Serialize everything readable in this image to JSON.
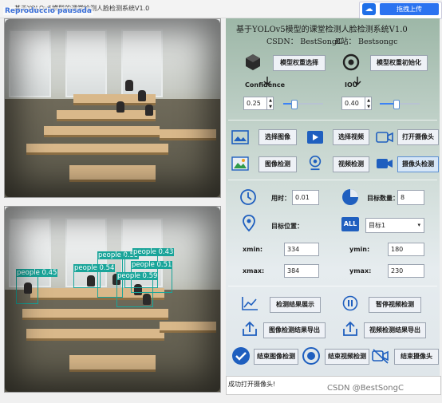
{
  "window": {
    "title": "基于YOLOv5模型的课堂检测人脸检测系统V1.0",
    "overlay_badge": "Reproduccio pausada",
    "upload_label": "拖拽上传"
  },
  "header": {
    "title": "基于YOLOv5模型的课堂检测人脸检测系统V1.0",
    "csdn": "CSDN： BestSongC",
    "bilibili": "B站： Bestsongc"
  },
  "model": {
    "select_label": "模型权重选择",
    "init_label": "模型权重初始化"
  },
  "params": {
    "confidence_label": "Confidence",
    "confidence_value": "0.25",
    "confidence_level": 0.25,
    "iou_label": "IOU",
    "iou_value": "0.40",
    "iou_level": 0.4
  },
  "source": {
    "image_label": "选择图像",
    "video_label": "选择视频",
    "camera_label": "打开摄像头",
    "image_detect_label": "图像检测",
    "video_detect_label": "视频检测",
    "camera_detect_label": "摄像头检测"
  },
  "stats": {
    "time_label": "用时：",
    "time_value": "0.01",
    "count_label": "目标数量：",
    "count_value": "8",
    "position_label": "目标位置：",
    "target_select": "目标1",
    "xmin_label": "xmin:",
    "xmin_value": "334",
    "ymin_label": "ymin:",
    "ymin_value": "180",
    "xmax_label": "xmax:",
    "xmax_value": "384",
    "ymax_label": "ymax:",
    "ymax_value": "230",
    "all_badge": "ALL"
  },
  "actions": {
    "show_results": "检测结果展示",
    "pause_video": "暂停视频检测",
    "export_image": "图像检测结果导出",
    "export_video": "视频检测结果导出",
    "stop_image": "结束图像检测",
    "stop_video": "结束视频检测",
    "stop_camera": "结束摄像头"
  },
  "status": {
    "message": "成功打开摄像头!"
  },
  "watermark": "CSDN @BestSongC",
  "detections": [
    {
      "label": "people  0.45"
    },
    {
      "label": "people  0.55"
    },
    {
      "label": "people  0.43"
    },
    {
      "label": "people  0.54"
    },
    {
      "label": "people  0.51"
    },
    {
      "label": "people  0.59"
    }
  ],
  "colors": {
    "accent": "#2b73f0",
    "detection_box": "#1aa59a"
  }
}
